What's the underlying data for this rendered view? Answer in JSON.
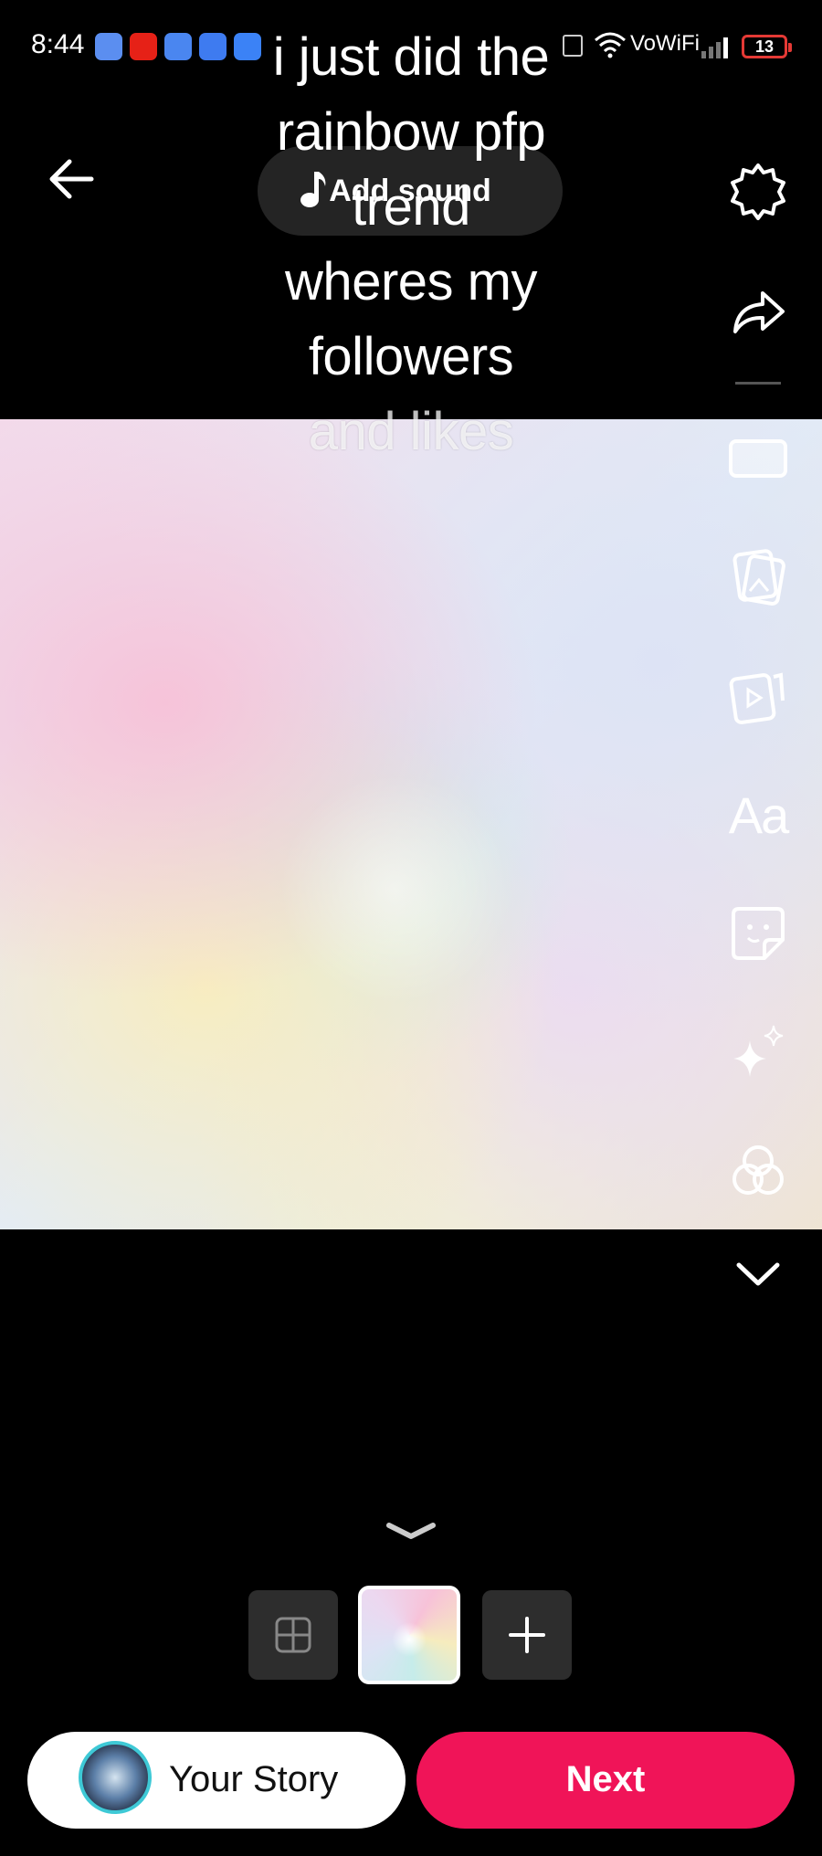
{
  "status_bar": {
    "time": "8:44",
    "network_label": "VoWiFi",
    "battery_level": "13",
    "notification_icons": [
      "messages-icon",
      "youtube-icon",
      "google-icon",
      "video-icon",
      "cloud-icon"
    ]
  },
  "caption": {
    "lines": [
      "i just did the",
      "rainbow pfp",
      "trend",
      "wheres my",
      "followers",
      "and likes"
    ]
  },
  "add_sound": {
    "label": "Add sound",
    "icon": "music-note-icon"
  },
  "tools": [
    "settings-icon",
    "share-icon",
    "template-icon",
    "photo-edit-icon",
    "video-edit-icon",
    "text-icon",
    "sticker-icon",
    "effects-icon",
    "filters-icon",
    "expand-icon"
  ],
  "text_tool_label": "Aa",
  "bottom": {
    "story_label": "Your Story",
    "next_label": "Next"
  },
  "colors": {
    "accent": "#f01458",
    "story_ring": "#3ec9d6",
    "battery": "#e53935"
  }
}
